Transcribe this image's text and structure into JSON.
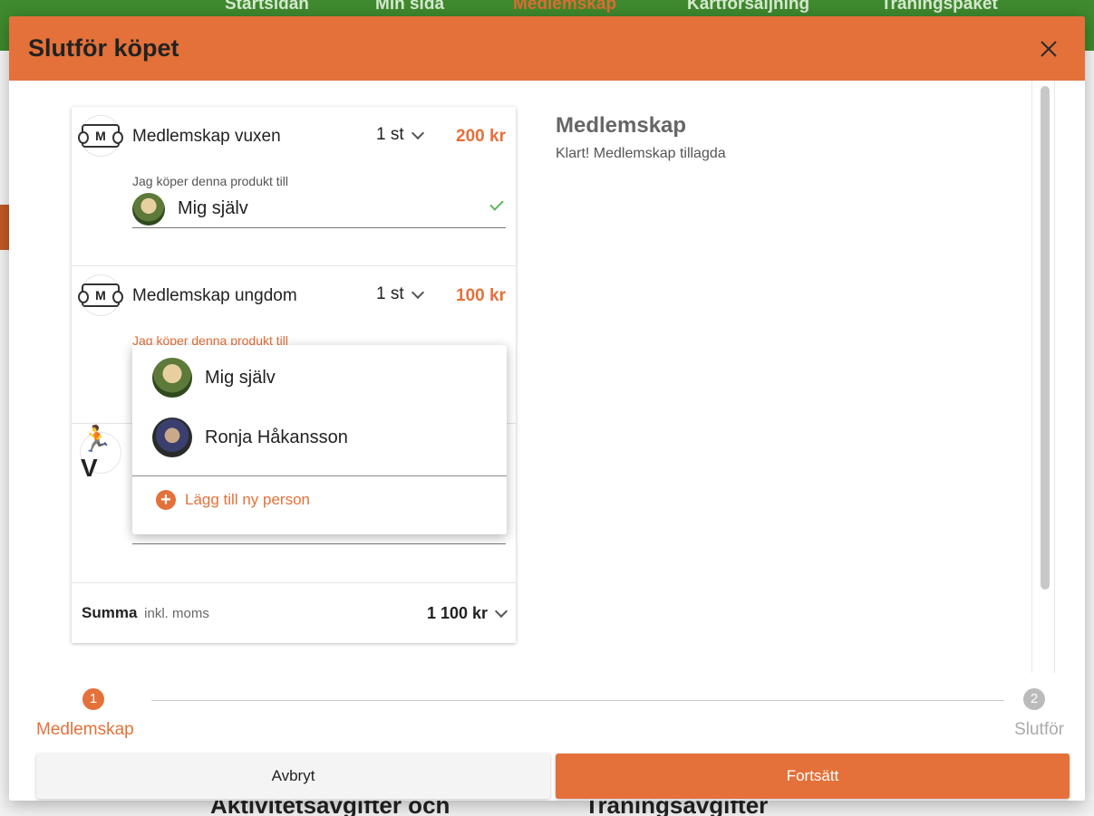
{
  "background": {
    "nav": [
      "Startsidan",
      "Min sida",
      "Medlemskap",
      "Kartförsäljning",
      "Träningspaket"
    ],
    "bottom_titles": [
      "Aktivitetsavgifter och",
      "Träningsavgifter"
    ]
  },
  "modal": {
    "title": "Slutför köpet",
    "close_icon": "close-icon"
  },
  "cart": {
    "items": [
      {
        "name": "Medlemskap vuxen",
        "quantity": "1 st",
        "price": "200 kr",
        "icon": "ticket-icon",
        "buyer_label": "Jag köper denna produkt till",
        "buyer": "Mig själv"
      },
      {
        "name": "Medlemskap ungdom",
        "quantity": "1 st",
        "price": "100 kr",
        "icon": "ticket-icon",
        "buyer_label": "Jag köper denna produkt till"
      },
      {
        "icon": "runner-icon"
      }
    ],
    "total": {
      "label": "Summa",
      "sublabel": "inkl. moms",
      "amount": "1 100 kr"
    }
  },
  "dropdown": {
    "options": [
      "Mig själv",
      "Ronja Håkansson"
    ],
    "add_label": "Lägg till ny person"
  },
  "info": {
    "title": "Medlemskap",
    "text": "Klart! Medlemskap tillagda"
  },
  "stepper": {
    "steps": [
      {
        "number": "1",
        "label": "Medlemskap"
      },
      {
        "number": "2",
        "label": "Slutför"
      }
    ]
  },
  "buttons": {
    "cancel": "Avbryt",
    "continue": "Fortsätt"
  },
  "colors": {
    "accent": "#e4713a",
    "nav_green": "#3f8a2e",
    "success": "#5cb85c"
  }
}
